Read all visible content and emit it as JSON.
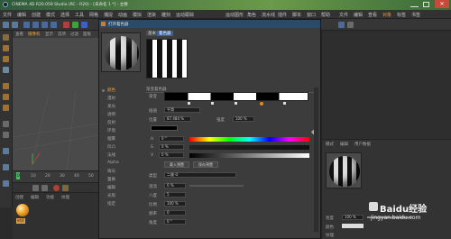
{
  "window": {
    "title": "CINEMA 4D R20.059 Studio (RC - R20) - [未命名 1 *] - 主要",
    "menu_left": [
      "文件",
      "编辑",
      "创建",
      "模式",
      "选择",
      "工具",
      "网格",
      "捕捉",
      "动画",
      "模拟",
      "渲染",
      "雕刻",
      "运动跟踪"
    ],
    "menu_right": [
      "运动图形",
      "角色",
      "流水线",
      "插件",
      "脚本",
      "窗口",
      "帮助"
    ],
    "right_tabs": [
      "文件",
      "编辑",
      "查看",
      "对象",
      "标签",
      "书签"
    ]
  },
  "viewport": {
    "menu": [
      "查看",
      "摄像机",
      "显示",
      "选项",
      "过滤",
      "面板"
    ]
  },
  "timeline": {
    "ticks": [
      "0",
      "10",
      "20",
      "30",
      "40",
      "50"
    ]
  },
  "material_manager": {
    "menu": [
      "创建",
      "编辑",
      "功能",
      "纹理"
    ],
    "material_label": "材质"
  },
  "dialog": {
    "title": "打开着色器",
    "tabs": [
      "基本",
      "着色器"
    ],
    "section_label": "渐变着色器",
    "gradient_label": "渐变",
    "interp_label": "插值",
    "interp_value": "平滑",
    "position_label": "位置",
    "position_value": "87.484 %",
    "intensity_label": "强度",
    "intensity_value": "100 %",
    "channels": [
      "H",
      "S",
      "V"
    ],
    "channel_values": [
      "0 °",
      "0 %",
      "0 %"
    ],
    "buttons": [
      "载入预置",
      "保存预置"
    ],
    "type_label": "类型",
    "type_value": "二维-U",
    "params": [
      {
        "label": "湍流",
        "value": "0 %"
      },
      {
        "label": "八度",
        "value": "5"
      },
      {
        "label": "比例",
        "value": "100 %"
      },
      {
        "label": "频率",
        "value": "0"
      },
      {
        "label": "角度",
        "value": "0 °"
      }
    ],
    "left_list": [
      "颜色",
      "漫射",
      "发光",
      "透明",
      "反射",
      "环境",
      "烟雾",
      "凹凸",
      "法线",
      "Alpha",
      "辉光",
      "置换",
      "编辑",
      "光照",
      "指定"
    ]
  },
  "attributes": {
    "tabs": [
      "模式",
      "编辑",
      "用户数据"
    ],
    "bottom_labels": [
      "亮度",
      "颜色",
      "纹理"
    ],
    "bottom_value": "100 %"
  },
  "watermark": {
    "text": "Baidu经验",
    "url": "jingyan.baidu.com"
  },
  "colors": {
    "title_bg": "#3a6b4a",
    "panel_bg": "#2b2b2b",
    "dialog_bg": "#3c3c3c",
    "accent_orange": "#e88a1a",
    "highlight_blue": "#3a5fa0"
  }
}
